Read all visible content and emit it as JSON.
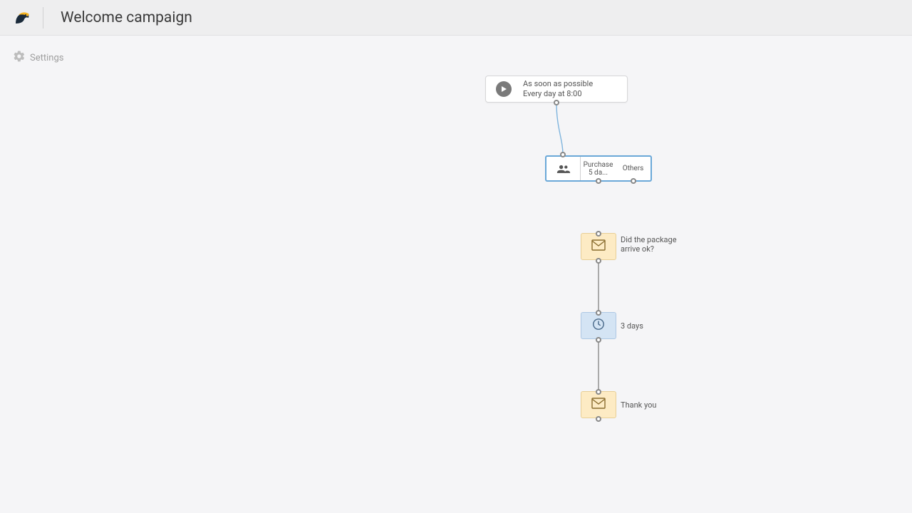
{
  "header": {
    "title": "Welcome campaign",
    "settings_label": "Settings"
  },
  "trigger": {
    "line1": "As soon as possible",
    "line2": "Every day at 8:00"
  },
  "split": {
    "seg1_line1": "Purchase",
    "seg1_line2": "5 da...",
    "seg2": "Others"
  },
  "nodes": {
    "email1_label": "Did the package arrive ok?",
    "wait_label": "3 days",
    "email2_label": "Thank you"
  }
}
